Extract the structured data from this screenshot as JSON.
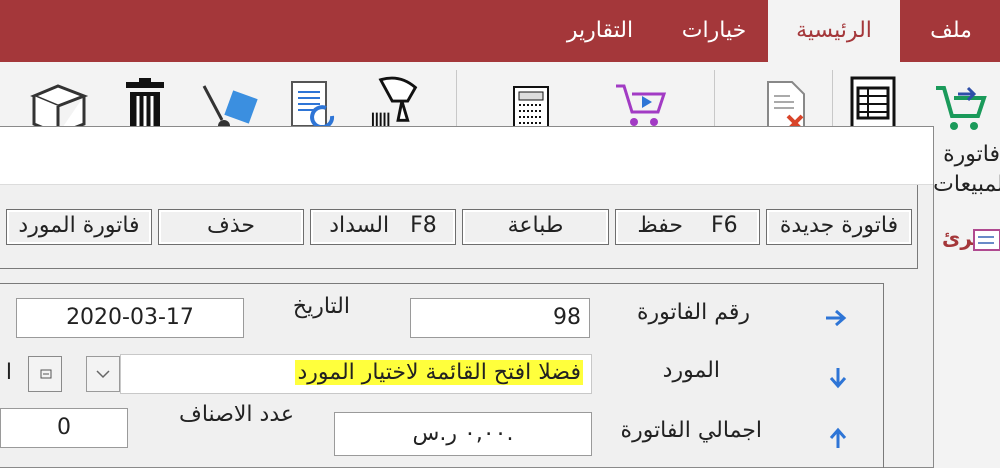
{
  "ribbon_tabs": [
    {
      "label": "ملف",
      "active": false
    },
    {
      "label": "الرئيسية",
      "active": true
    },
    {
      "label": "خيارات",
      "active": false
    },
    {
      "label": "التقارير",
      "active": false
    }
  ],
  "ribbon": {
    "sales_invoice_label_line1": "فاتورة",
    "sales_invoice_label_line2": "المبيعات",
    "icons": [
      "cart-arrow-icon",
      "document-list-icon",
      "document-delete-icon",
      "cart-play-icon",
      "calculator-icon",
      "barcode-scanner-icon",
      "document-refresh-icon",
      "hand-truck-icon",
      "trash-icon",
      "box-icon"
    ]
  },
  "side_panel": {
    "item_label": "الرئ"
  },
  "toolbar": {
    "new_invoice": "فاتورة جديدة",
    "save": "حفظ    F6",
    "print": "طباعة",
    "payment": "السداد   F8",
    "delete": "حذف",
    "supplier_invoice": "فاتورة المورد"
  },
  "form": {
    "invoice_number_label": "رقم الفاتورة",
    "invoice_number_value": "98",
    "date_label": "التاريخ",
    "date_value": "2020-03-17",
    "supplier_label": "المورد",
    "supplier_placeholder": "فضلا افتح القائمة لاختيار المورد",
    "supplier_cut_label": "ا",
    "invoice_total_label": "اجمالي الفاتورة",
    "invoice_total_value": "٠,٠٠ ر.س.",
    "items_count_label": "عدد الاصناف",
    "items_count_value": "0"
  },
  "colors": {
    "accent": "#a4373a",
    "highlight": "#ffff3c",
    "arrow_blue": "#2e75d6"
  }
}
